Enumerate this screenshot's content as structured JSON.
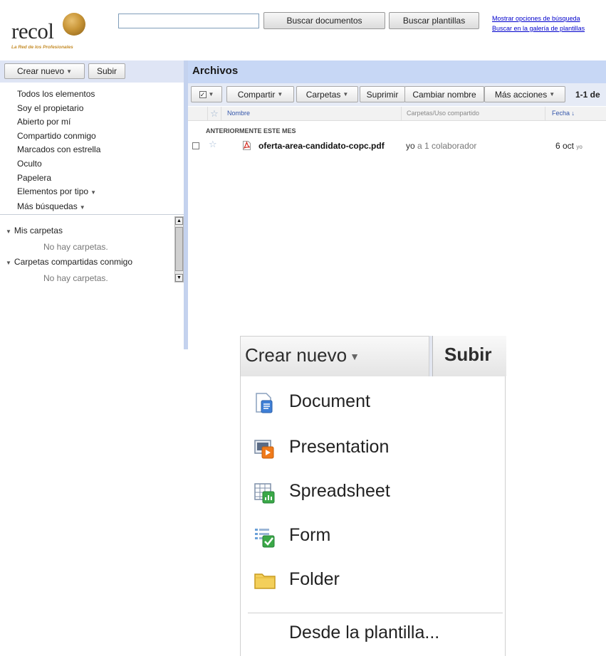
{
  "header": {
    "logo_text": "recol",
    "logo_tagline": "La Red de los Profesionales",
    "search_value": "",
    "search_docs_button": "Buscar documentos",
    "search_templates_button": "Buscar plantillas",
    "link_show_options": "Mostrar opciones de búsqueda",
    "link_template_gallery": "Buscar en la galería de plantillas"
  },
  "sidebar": {
    "create_new": "Crear nuevo",
    "upload": "Subir",
    "nav_items": [
      "Todos los elementos",
      "Soy el propietario",
      "Abierto por mí",
      "Compartido conmigo",
      "Marcados con estrella",
      "Oculto",
      "Papelera",
      "Elementos por tipo",
      "Más búsquedas"
    ],
    "my_folders": "Mis carpetas",
    "my_folders_empty": "No hay carpetas.",
    "shared_folders": "Carpetas compartidas conmigo",
    "shared_folders_empty": "No hay carpetas."
  },
  "main": {
    "title": "Archivos",
    "toolbar": {
      "share": "Compartir",
      "folders": "Carpetas",
      "delete": "Suprimir",
      "rename": "Cambiar nombre",
      "more_actions": "Más acciones",
      "count": "1-1 de"
    },
    "columns": {
      "name": "Nombre",
      "folders_sharing": "Carpetas/Uso compartido",
      "date": "Fecha"
    },
    "group_label": "ANTERIORMENTE ESTE MES",
    "files": [
      {
        "name": "oferta-area-candidato-copc.pdf",
        "owner": "yo",
        "sharing": "a 1 colaborador",
        "date": "6 oct",
        "modified_by": "yo"
      }
    ]
  },
  "zoom_menu": {
    "create_new": "Crear nuevo",
    "upload": "Subir",
    "items": [
      {
        "label": "Document",
        "icon": "document-icon"
      },
      {
        "label": "Presentation",
        "icon": "presentation-icon"
      },
      {
        "label": "Spreadsheet",
        "icon": "spreadsheet-icon"
      },
      {
        "label": "Form",
        "icon": "form-icon"
      },
      {
        "label": "Folder",
        "icon": "folder-icon"
      }
    ],
    "from_template": "Desde la plantilla..."
  },
  "colors": {
    "header_blue": "#c7d7f5",
    "toolbar_blue": "#e6ebf6",
    "sidebar_bar": "#dfe5f5",
    "link_blue": "#0000cc",
    "logo_gold": "#c99638"
  }
}
